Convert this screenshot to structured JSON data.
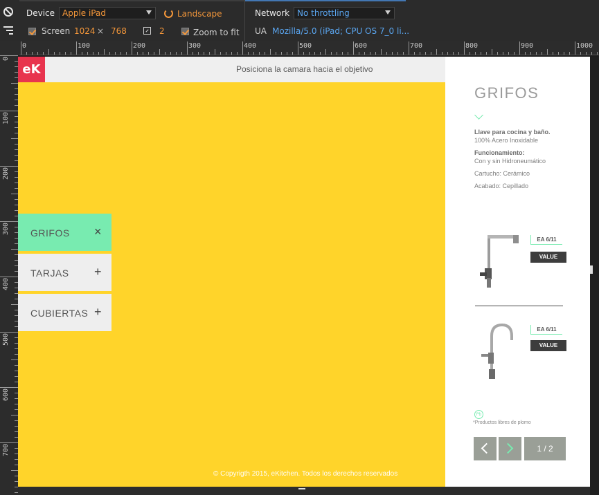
{
  "toolbar": {
    "device_label": "Device",
    "device_value": "Apple iPad",
    "orientation": "Landscape",
    "network_label": "Network",
    "network_value": "No throttling",
    "screen_label": "Screen",
    "screen_width": "1024",
    "times": "×",
    "screen_height": "768",
    "pixel_ratio": "2",
    "zoom_label": "Zoom to fit",
    "ua_label": "UA",
    "ua_value": "Mozilla/5.0 (iPad; CPU OS 7_0 li..."
  },
  "ruler": {
    "top_labels": [
      "0",
      "100",
      "200",
      "300",
      "400",
      "500",
      "600",
      "700",
      "800",
      "900",
      "1000"
    ],
    "left_labels": [
      "0",
      "100",
      "200",
      "300",
      "400",
      "500",
      "600",
      "700"
    ]
  },
  "header": {
    "logo": "eK",
    "instruction": "Posiciona la camara hacia el objetivo"
  },
  "menu": [
    {
      "label": "GRIFOS",
      "symbol": "×"
    },
    {
      "label": "TARJAS",
      "symbol": "+"
    },
    {
      "label": "CUBIERTAS",
      "symbol": "+"
    }
  ],
  "panel": {
    "title": "GRIFOS",
    "specs": [
      "Llave para cocina y baño.",
      "100% Acero Inoxidable",
      "Funcionamiento:",
      "Con y sin Hidroneumático",
      "Cartucho: Cerámico",
      "Acabado: Cepillado"
    ],
    "products": [
      {
        "code": "EA 6/11",
        "button": "VALUE"
      },
      {
        "code": "EA 6/11",
        "button": "VALUE"
      }
    ],
    "lead_icon": "Pb",
    "lead_text": "*Productos libres de plomo",
    "pager": "1 / 2"
  },
  "footer": {
    "copyright": "© Copyrigth 2015, eKitchen. Todos los derechos reservados"
  },
  "colors": {
    "background": "#ffd42a",
    "accent": "#78ebb0",
    "logo": "#e8344e"
  }
}
